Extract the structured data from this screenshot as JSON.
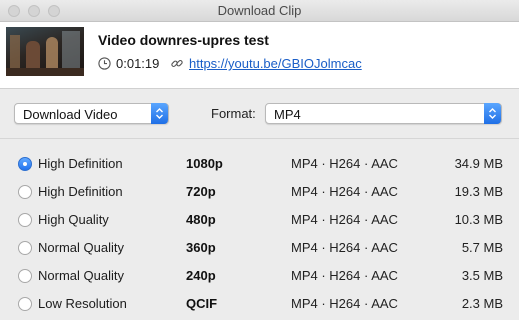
{
  "window": {
    "title": "Download Clip"
  },
  "video": {
    "title": "Video downres-upres test",
    "duration": "0:01:19",
    "url": "https://youtu.be/GBIOJolmcac"
  },
  "controls": {
    "action": "Download Video",
    "format_label": "Format:",
    "format": "MP4"
  },
  "qualities": [
    {
      "label": "High Definition",
      "resolution": "1080p",
      "format": "MP4 · H264 · AAC",
      "size": "34.9 MB",
      "selected": true
    },
    {
      "label": "High Definition",
      "resolution": "720p",
      "format": "MP4 · H264 · AAC",
      "size": "19.3 MB",
      "selected": false
    },
    {
      "label": "High Quality",
      "resolution": "480p",
      "format": "MP4 · H264 · AAC",
      "size": "10.3 MB",
      "selected": false
    },
    {
      "label": "Normal Quality",
      "resolution": "360p",
      "format": "MP4 · H264 · AAC",
      "size": "5.7 MB",
      "selected": false
    },
    {
      "label": "Normal Quality",
      "resolution": "240p",
      "format": "MP4 · H264 · AAC",
      "size": "3.5 MB",
      "selected": false
    },
    {
      "label": "Low Resolution",
      "resolution": "QCIF",
      "format": "MP4 · H264 · AAC",
      "size": "2.3 MB",
      "selected": false
    }
  ],
  "colors": {
    "accent": "#2374ef",
    "link": "#1a5ec7"
  }
}
